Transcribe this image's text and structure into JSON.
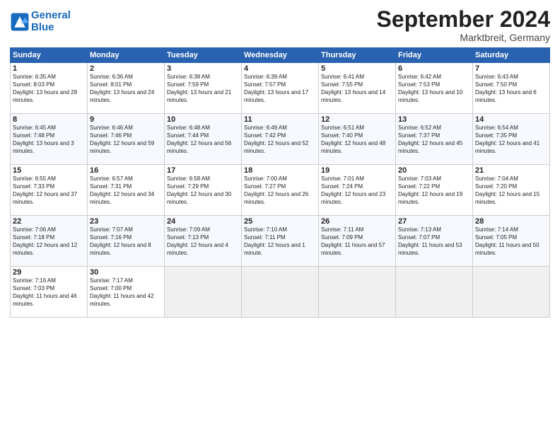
{
  "header": {
    "logo_line1": "General",
    "logo_line2": "Blue",
    "month_title": "September 2024",
    "location": "Marktbreit, Germany"
  },
  "weekdays": [
    "Sunday",
    "Monday",
    "Tuesday",
    "Wednesday",
    "Thursday",
    "Friday",
    "Saturday"
  ],
  "weeks": [
    [
      {
        "day": "1",
        "sunrise": "Sunrise: 6:35 AM",
        "sunset": "Sunset: 8:03 PM",
        "daylight": "Daylight: 13 hours and 28 minutes."
      },
      {
        "day": "2",
        "sunrise": "Sunrise: 6:36 AM",
        "sunset": "Sunset: 8:01 PM",
        "daylight": "Daylight: 13 hours and 24 minutes."
      },
      {
        "day": "3",
        "sunrise": "Sunrise: 6:38 AM",
        "sunset": "Sunset: 7:59 PM",
        "daylight": "Daylight: 13 hours and 21 minutes."
      },
      {
        "day": "4",
        "sunrise": "Sunrise: 6:39 AM",
        "sunset": "Sunset: 7:57 PM",
        "daylight": "Daylight: 13 hours and 17 minutes."
      },
      {
        "day": "5",
        "sunrise": "Sunrise: 6:41 AM",
        "sunset": "Sunset: 7:55 PM",
        "daylight": "Daylight: 13 hours and 14 minutes."
      },
      {
        "day": "6",
        "sunrise": "Sunrise: 6:42 AM",
        "sunset": "Sunset: 7:53 PM",
        "daylight": "Daylight: 13 hours and 10 minutes."
      },
      {
        "day": "7",
        "sunrise": "Sunrise: 6:43 AM",
        "sunset": "Sunset: 7:50 PM",
        "daylight": "Daylight: 13 hours and 6 minutes."
      }
    ],
    [
      {
        "day": "8",
        "sunrise": "Sunrise: 6:45 AM",
        "sunset": "Sunset: 7:48 PM",
        "daylight": "Daylight: 13 hours and 3 minutes."
      },
      {
        "day": "9",
        "sunrise": "Sunrise: 6:46 AM",
        "sunset": "Sunset: 7:46 PM",
        "daylight": "Daylight: 12 hours and 59 minutes."
      },
      {
        "day": "10",
        "sunrise": "Sunrise: 6:48 AM",
        "sunset": "Sunset: 7:44 PM",
        "daylight": "Daylight: 12 hours and 56 minutes."
      },
      {
        "day": "11",
        "sunrise": "Sunrise: 6:49 AM",
        "sunset": "Sunset: 7:42 PM",
        "daylight": "Daylight: 12 hours and 52 minutes."
      },
      {
        "day": "12",
        "sunrise": "Sunrise: 6:51 AM",
        "sunset": "Sunset: 7:40 PM",
        "daylight": "Daylight: 12 hours and 48 minutes."
      },
      {
        "day": "13",
        "sunrise": "Sunrise: 6:52 AM",
        "sunset": "Sunset: 7:37 PM",
        "daylight": "Daylight: 12 hours and 45 minutes."
      },
      {
        "day": "14",
        "sunrise": "Sunrise: 6:54 AM",
        "sunset": "Sunset: 7:35 PM",
        "daylight": "Daylight: 12 hours and 41 minutes."
      }
    ],
    [
      {
        "day": "15",
        "sunrise": "Sunrise: 6:55 AM",
        "sunset": "Sunset: 7:33 PM",
        "daylight": "Daylight: 12 hours and 37 minutes."
      },
      {
        "day": "16",
        "sunrise": "Sunrise: 6:57 AM",
        "sunset": "Sunset: 7:31 PM",
        "daylight": "Daylight: 12 hours and 34 minutes."
      },
      {
        "day": "17",
        "sunrise": "Sunrise: 6:58 AM",
        "sunset": "Sunset: 7:29 PM",
        "daylight": "Daylight: 12 hours and 30 minutes."
      },
      {
        "day": "18",
        "sunrise": "Sunrise: 7:00 AM",
        "sunset": "Sunset: 7:27 PM",
        "daylight": "Daylight: 12 hours and 26 minutes."
      },
      {
        "day": "19",
        "sunrise": "Sunrise: 7:01 AM",
        "sunset": "Sunset: 7:24 PM",
        "daylight": "Daylight: 12 hours and 23 minutes."
      },
      {
        "day": "20",
        "sunrise": "Sunrise: 7:03 AM",
        "sunset": "Sunset: 7:22 PM",
        "daylight": "Daylight: 12 hours and 19 minutes."
      },
      {
        "day": "21",
        "sunrise": "Sunrise: 7:04 AM",
        "sunset": "Sunset: 7:20 PM",
        "daylight": "Daylight: 12 hours and 15 minutes."
      }
    ],
    [
      {
        "day": "22",
        "sunrise": "Sunrise: 7:06 AM",
        "sunset": "Sunset: 7:18 PM",
        "daylight": "Daylight: 12 hours and 12 minutes."
      },
      {
        "day": "23",
        "sunrise": "Sunrise: 7:07 AM",
        "sunset": "Sunset: 7:16 PM",
        "daylight": "Daylight: 12 hours and 8 minutes."
      },
      {
        "day": "24",
        "sunrise": "Sunrise: 7:09 AM",
        "sunset": "Sunset: 7:13 PM",
        "daylight": "Daylight: 12 hours and 4 minutes."
      },
      {
        "day": "25",
        "sunrise": "Sunrise: 7:10 AM",
        "sunset": "Sunset: 7:11 PM",
        "daylight": "Daylight: 12 hours and 1 minute."
      },
      {
        "day": "26",
        "sunrise": "Sunrise: 7:11 AM",
        "sunset": "Sunset: 7:09 PM",
        "daylight": "Daylight: 11 hours and 57 minutes."
      },
      {
        "day": "27",
        "sunrise": "Sunrise: 7:13 AM",
        "sunset": "Sunset: 7:07 PM",
        "daylight": "Daylight: 11 hours and 53 minutes."
      },
      {
        "day": "28",
        "sunrise": "Sunrise: 7:14 AM",
        "sunset": "Sunset: 7:05 PM",
        "daylight": "Daylight: 11 hours and 50 minutes."
      }
    ],
    [
      {
        "day": "29",
        "sunrise": "Sunrise: 7:16 AM",
        "sunset": "Sunset: 7:03 PM",
        "daylight": "Daylight: 11 hours and 46 minutes."
      },
      {
        "day": "30",
        "sunrise": "Sunrise: 7:17 AM",
        "sunset": "Sunset: 7:00 PM",
        "daylight": "Daylight: 11 hours and 42 minutes."
      },
      null,
      null,
      null,
      null,
      null
    ]
  ]
}
